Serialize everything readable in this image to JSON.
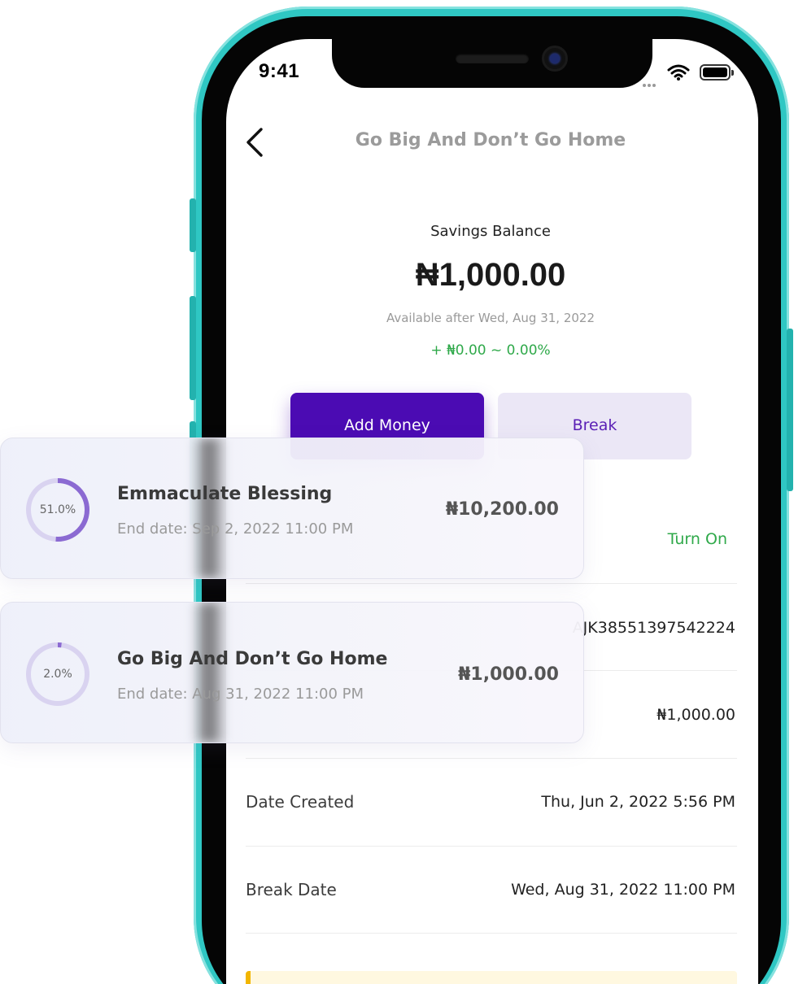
{
  "status_bar": {
    "time": "9:41"
  },
  "header": {
    "title": "Go Big And Don’t Go Home"
  },
  "balance": {
    "label": "Savings Balance",
    "amount": "₦1,000.00",
    "available_note": "Available after Wed, Aug 31, 2022",
    "gain": "+ ₦0.00 ~ 0.00%"
  },
  "actions": {
    "add_money_label": "Add Money",
    "break_label": "Break"
  },
  "autosave": {
    "toggle_label": "Turn On"
  },
  "details": {
    "reference_value": "AJK38551397542224",
    "amount_value": "₦1,000.00",
    "rows": [
      {
        "label": "Date Created",
        "value": "Thu, Jun 2, 2022 5:56 PM"
      },
      {
        "label": "Break Date",
        "value": "Wed, Aug 31, 2022 11:00 PM"
      }
    ]
  },
  "cards": [
    {
      "progress": 0.51,
      "progress_label": "51.0%",
      "name": "Emmaculate Blessing",
      "end_date": "End date: Sep 2, 2022 11:00 PM",
      "amount": "₦10,200.00"
    },
    {
      "progress": 0.02,
      "progress_label": "2.0%",
      "name": "Go Big And Don’t Go Home",
      "end_date": "End date: Aug 31, 2022 11:00 PM",
      "amount": "₦1,000.00"
    }
  ],
  "colors": {
    "phone_frame": "#2fc7c3",
    "primary": "#4b0bb3",
    "secondary_bg": "#ebe7f6",
    "positive": "#2fa94a",
    "ring_track": "#d9d3f0",
    "ring_fill": "#8b6ad2"
  },
  "icons": {
    "back": "chevron-left-icon",
    "wifi": "wifi-icon",
    "battery": "battery-icon",
    "camera": "camera-icon"
  }
}
